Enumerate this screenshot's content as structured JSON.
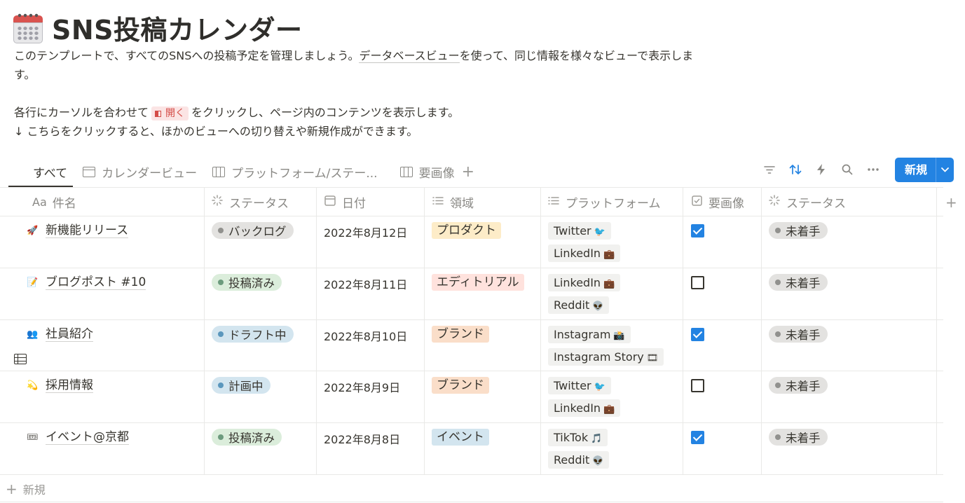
{
  "page": {
    "icon": "calendar-icon",
    "title": "SNS投稿カレンダー",
    "desc1_before": "このテンプレートで、すべてのSNSへの投稿予定を管理しましょう。",
    "desc1_link": "データベースビュー",
    "desc1_after": "を使って、同じ情報を様々なビューで表示します。",
    "desc2_before": "各行にカーソルを合わせて",
    "desc2_chip": "開く",
    "desc2_after": "をクリックし、ページ内のコンテンツを表示します。",
    "desc3": "↓ こちらをクリックすると、ほかのビューへの切り替えや新規作成ができます。"
  },
  "tabs": [
    {
      "label": "すべて",
      "icon": "table-icon"
    },
    {
      "label": "カレンダービュー",
      "icon": "calendar-view-icon"
    },
    {
      "label": "プラットフォーム/ステー...",
      "icon": "board-icon"
    },
    {
      "label": "要画像",
      "icon": "board-icon"
    }
  ],
  "toolbar": {
    "new_label": "新規",
    "icons": [
      "filter-icon",
      "sort-icon",
      "automation-icon",
      "search-icon",
      "more-icon"
    ]
  },
  "columns": [
    {
      "label": "件名",
      "icon_text": "Aa"
    },
    {
      "label": "ステータス",
      "icon": "status-icon"
    },
    {
      "label": "日付",
      "icon": "date-icon"
    },
    {
      "label": "領域",
      "icon": "list-icon"
    },
    {
      "label": "プラットフォーム",
      "icon": "list-icon"
    },
    {
      "label": "要画像",
      "icon": "checkbox-icon"
    },
    {
      "label": "ステータス",
      "icon": "status-icon"
    }
  ],
  "rows": [
    {
      "emoji": "🚀",
      "name": "新機能リリース",
      "status": "バックログ",
      "status_color": "#e3e2e0",
      "status_dot": "#91918e",
      "date": "2022年8月12日",
      "area": "プロダクト",
      "area_bg": "#fdecc8",
      "platforms": [
        {
          "label": "Twitter",
          "emoji": "🐦"
        },
        {
          "label": "LinkedIn",
          "emoji": "💼"
        }
      ],
      "needs_image": true,
      "status2": "未着手"
    },
    {
      "emoji": "📝",
      "name": "ブログポスト #10",
      "status": "投稿済み",
      "status_color": "#dbeddb",
      "status_dot": "#6c9b7d",
      "date": "2022年8月11日",
      "area": "エディトリアル",
      "area_bg": "#ffe2dd",
      "platforms": [
        {
          "label": "LinkedIn",
          "emoji": "💼"
        },
        {
          "label": "Reddit",
          "emoji": "👽"
        }
      ],
      "needs_image": false,
      "status2": "未着手"
    },
    {
      "emoji": "👥",
      "name": "社員紹介",
      "status": "ドラフト中",
      "status_color": "#d3e5ef",
      "status_dot": "#5b97bd",
      "date": "2022年8月10日",
      "area": "ブランド",
      "area_bg": "#fadec9",
      "platforms": [
        {
          "label": "Instagram",
          "emoji": "📸"
        },
        {
          "label": "Instagram Story",
          "emoji": "🎞"
        }
      ],
      "needs_image": true,
      "status2": "未着手"
    },
    {
      "emoji": "💫",
      "name": "採用情報",
      "status": "計画中",
      "status_color": "#d3e5ef",
      "status_dot": "#5b97bd",
      "date": "2022年8月9日",
      "area": "ブランド",
      "area_bg": "#fadec9",
      "platforms": [
        {
          "label": "Twitter",
          "emoji": "🐦"
        },
        {
          "label": "LinkedIn",
          "emoji": "💼"
        }
      ],
      "needs_image": false,
      "status2": "未着手"
    },
    {
      "emoji": "🎟",
      "name": "イベント@京都",
      "status": "投稿済み",
      "status_color": "#dbeddb",
      "status_dot": "#6c9b7d",
      "date": "2022年8月8日",
      "area": "イベント",
      "area_bg": "#d3e5ef",
      "platforms": [
        {
          "label": "TikTok",
          "emoji": "🎵"
        },
        {
          "label": "Reddit",
          "emoji": "👽"
        }
      ],
      "needs_image": true,
      "status2": "未着手"
    }
  ],
  "new_row_label": "新規"
}
